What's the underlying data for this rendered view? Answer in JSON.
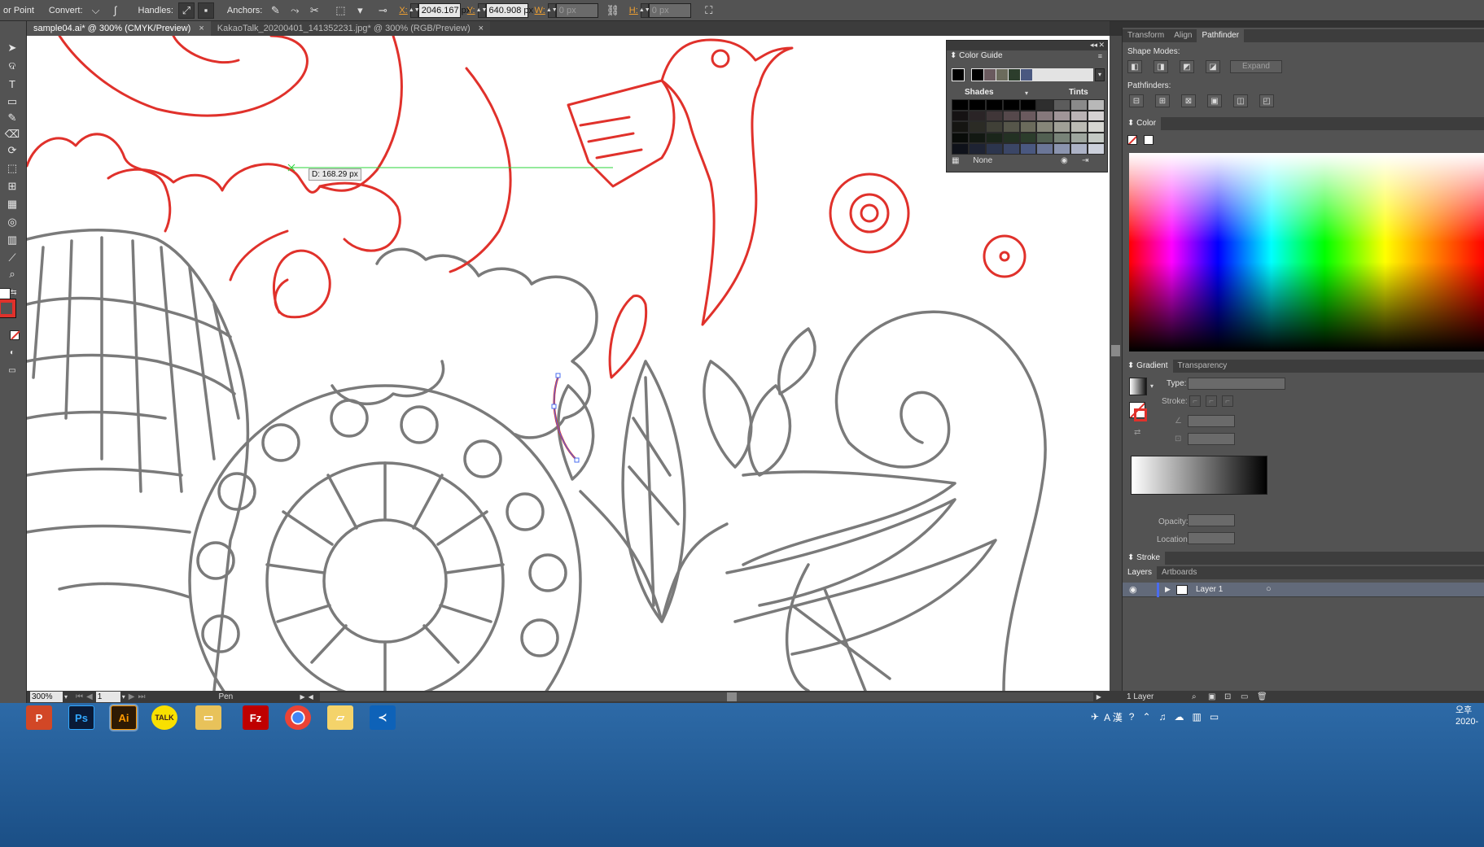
{
  "control_bar": {
    "convert_prefix": "or Point",
    "convert_label": "Convert:",
    "handles_label": "Handles:",
    "anchors_label": "Anchors:",
    "x_label": "X:",
    "x_value": "2046.167 px",
    "y_label": "Y:",
    "y_value": "640.908 px",
    "w_label": "W:",
    "w_value": "0 px",
    "h_label": "H:",
    "h_value": "0 px"
  },
  "document_tabs": [
    {
      "title": "sample04.ai* @ 300% (CMYK/Preview)",
      "close": "×"
    },
    {
      "title": "KakaoTalk_20200401_141352231.jpg* @ 300% (RGB/Preview)",
      "close": "×"
    }
  ],
  "canvas": {
    "measure_tooltip": "D: 168.29 px"
  },
  "color_guide": {
    "title": "Color Guide",
    "shades_label": "Shades",
    "tints_label": "Tints",
    "none_label": "None",
    "harmony_swatches": [
      "#000000",
      "#6a5a5e",
      "#6b6b5c",
      "#2c3d2c",
      "#4a5880"
    ]
  },
  "panels": {
    "top_tabs": [
      "Transform",
      "Align",
      "Pathfinder"
    ],
    "shape_modes_label": "Shape Modes:",
    "expand_label": "Expand",
    "pathfinders_label": "Pathfinders:",
    "color_tab": "Color",
    "gradient_tabs": [
      "Gradient",
      "Transparency"
    ],
    "type_label": "Type:",
    "stroke_label": "Stroke:",
    "opacity_label": "Opacity:",
    "location_label": "Location:",
    "stroke_tab": "Stroke",
    "layers_tabs": [
      "Layers",
      "Artboards"
    ],
    "layer_name": "Layer 1",
    "layers_count": "1 Layer"
  },
  "status_bar": {
    "zoom": "300%",
    "artboard": "1",
    "tool_name": "Pen"
  },
  "taskbar": {
    "apps": [
      "PowerPoint",
      "Photoshop",
      "Illustrator",
      "KakaoTalk",
      "File Explorer",
      "FileZilla",
      "Chrome",
      "Folder",
      "VS Code"
    ],
    "app_glyphs": [
      "P",
      "Ps",
      "Ai",
      "TALK",
      "",
      "Fz",
      "",
      "",
      ""
    ],
    "tray_text": "A 漢",
    "clock_time": "오후",
    "clock_date": "2020-"
  },
  "colors": {
    "ui_bg": "#535353",
    "ui_dark": "#323232",
    "accent_red": "#e0312b",
    "stroke_gray": "#707070",
    "taskbar_blue": "#2d6aa7"
  }
}
